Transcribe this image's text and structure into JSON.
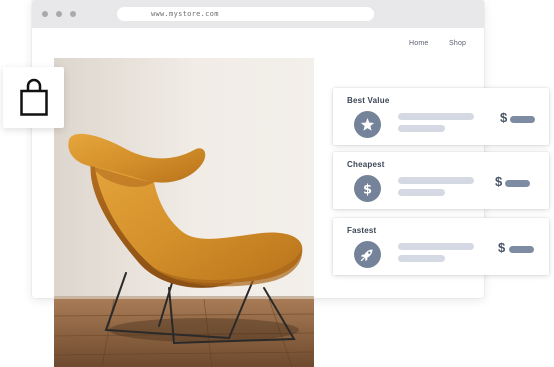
{
  "browser": {
    "url": "www.mystore.com",
    "nav": [
      "Home",
      "Shop"
    ]
  },
  "product": {
    "image": "orange-leather-lounge-chair",
    "icon": "shopping-bag-icon"
  },
  "options": [
    {
      "title": "Best Value",
      "icon": "star-icon",
      "price_symbol": "$"
    },
    {
      "title": "Cheapest",
      "icon": "dollar-icon",
      "price_symbol": "$"
    },
    {
      "title": "Fastest",
      "icon": "rocket-icon",
      "price_symbol": "$"
    }
  ],
  "colors": {
    "chrome": "#e8e8ea",
    "icon_circle": "#74839a",
    "placeholder_bar": "#d4d9e3",
    "price_bar": "#7d8ca3",
    "title_text": "#3b4656"
  }
}
